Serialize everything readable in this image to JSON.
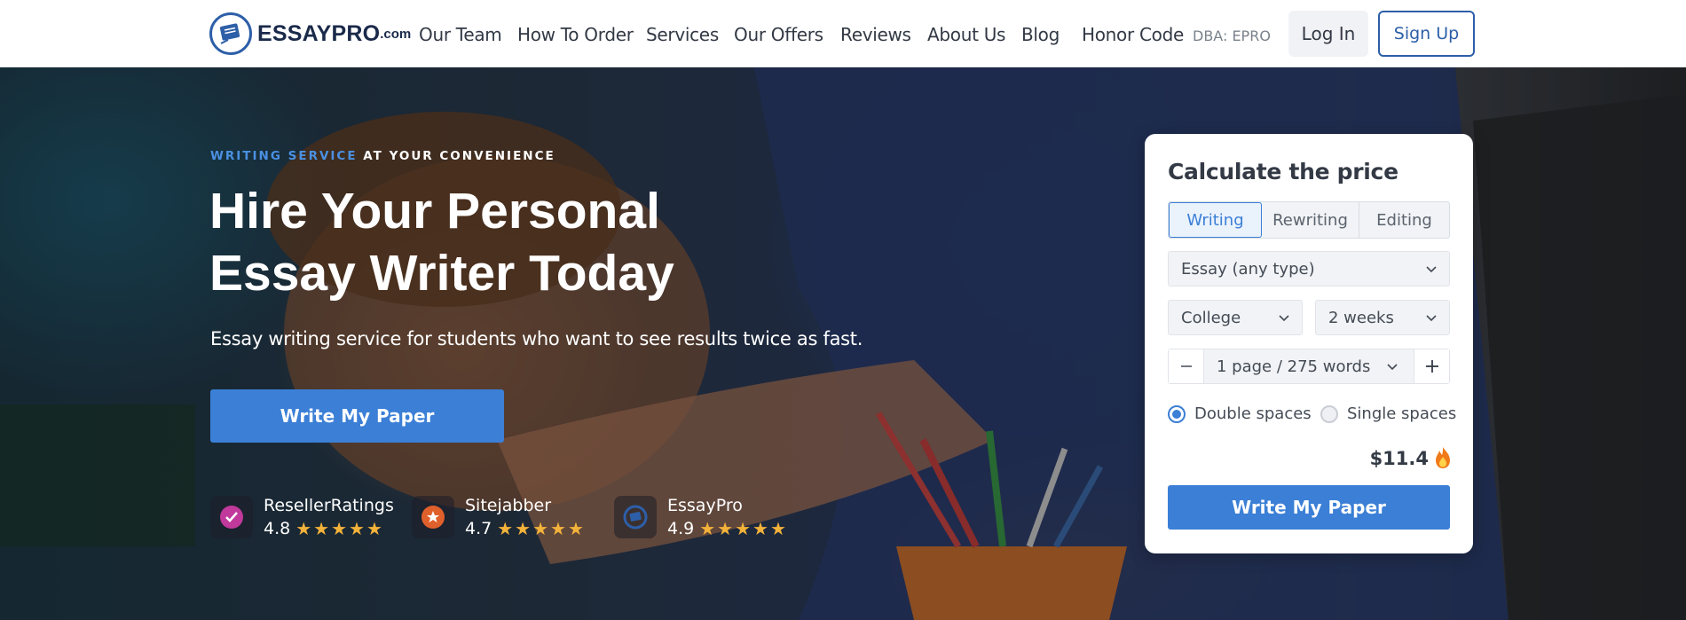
{
  "header": {
    "logo_main": "ESSAYPRO",
    "logo_suffix": ".com",
    "nav": [
      "Our Team",
      "How To Order",
      "Services",
      "Our Offers",
      "Reviews",
      "About Us",
      "Blog",
      "Honor Code"
    ],
    "dba": "DBA: EPRO",
    "login_label": "Log In",
    "signup_label": "Sign Up"
  },
  "hero": {
    "eyebrow_highlight": "WRITING SERVICE",
    "eyebrow_rest": "AT YOUR CONVENIENCE",
    "title_line1": "Hire Your Personal",
    "title_line2": "Essay Writer Today",
    "subtitle": "Essay writing service for students who want to see results twice as fast.",
    "cta_label": "Write My Paper"
  },
  "ratings": [
    {
      "name": "ResellerRatings",
      "score": "4.8",
      "stars": "★★★★★",
      "icon": "resellerratings-icon",
      "color": "#c0399b"
    },
    {
      "name": "Sitejabber",
      "score": "4.7",
      "stars": "★★★★★",
      "icon": "sitejabber-icon",
      "color": "#e0602b"
    },
    {
      "name": "EssayPro",
      "score": "4.9",
      "stars": "★★★★★",
      "icon": "essaypro-icon",
      "color": "#2d5fa8"
    }
  ],
  "calculator": {
    "title": "Calculate the price",
    "tabs": [
      "Writing",
      "Rewriting",
      "Editing"
    ],
    "active_tab": "Writing",
    "paper_type": "Essay (any type)",
    "academic_level": "College",
    "deadline": "2 weeks",
    "pages": "1 page / 275 words",
    "spacing_options": [
      "Double spaces",
      "Single spaces"
    ],
    "selected_spacing": "Double spaces",
    "price": "$11.4",
    "cta_label": "Write My Paper"
  },
  "colors": {
    "accent": "#3b7fd6",
    "brand": "#2d5fa8",
    "star": "#f3b23a"
  }
}
